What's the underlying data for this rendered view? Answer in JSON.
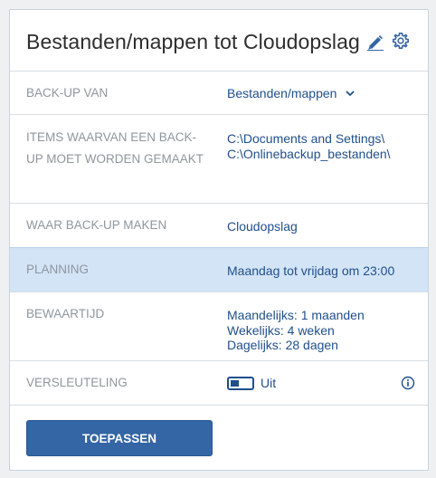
{
  "header": {
    "title": "Bestanden/mappen tot Cloudopslag",
    "edit_icon": "pencil-icon",
    "settings_icon": "gear-icon"
  },
  "rows": [
    {
      "label": "BACK-UP VAN",
      "value": "Bestanden/mappen",
      "has_dropdown": true
    },
    {
      "label": "ITEMS WAARVAN EEN BACK-UP MOET WORDEN GEMAAKT",
      "values": [
        "C:\\Documents and Settings\\",
        "C:\\Onlinebackup_bestanden\\"
      ]
    },
    {
      "label": "WAAR BACK-UP MAKEN",
      "value": "Cloudopslag"
    },
    {
      "label": "PLANNING",
      "value": "Maandag tot vrijdag om 23:00",
      "highlighted": true
    },
    {
      "label": "BEWAARTIJD",
      "values": [
        "Maandelijks: 1 maanden",
        "Wekelijks: 4 weken",
        "Dagelijks: 28 dagen"
      ]
    },
    {
      "label": "VERSLEUTELING",
      "toggle_label": "Uit",
      "toggle_on": false,
      "info_icon": "info-icon"
    }
  ],
  "apply_button": "TOEPASSEN",
  "colors": {
    "accent": "#1f4f8b",
    "button": "#3465a4",
    "highlight": "#d3e4f7",
    "label": "#8e969d"
  }
}
